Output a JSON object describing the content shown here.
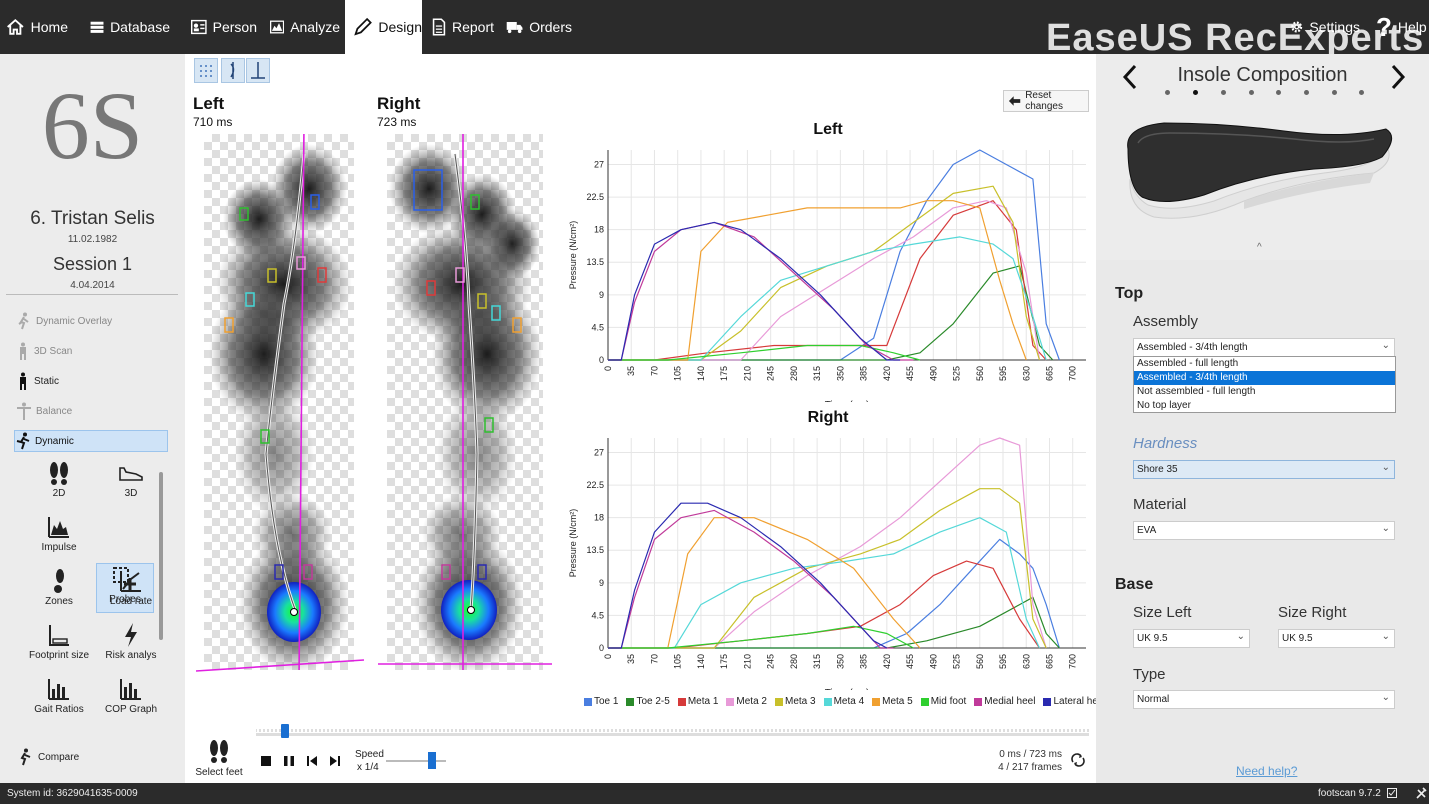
{
  "nav": {
    "home": "Home",
    "database": "Database",
    "person": "Person",
    "analyze": "Analyze",
    "design": "Design",
    "report": "Report",
    "orders": "Orders",
    "settings": "Settings",
    "help": "Help"
  },
  "watermark": "EaseUS RecExperts",
  "patient": {
    "size": "6S",
    "name": "6. Tristan Selis",
    "dob": "11.02.1982",
    "session": "Session 1",
    "session_date": "4.04.2014"
  },
  "menu": {
    "dynamic_overlay": "Dynamic Overlay",
    "scan_3d": "3D Scan",
    "static": "Static",
    "balance": "Balance",
    "dynamic": "Dynamic",
    "compare": "Compare"
  },
  "tools": {
    "t2d": "2D",
    "t3d": "3D",
    "impulse": "Impulse",
    "probes": "Probes",
    "zones": "Zones",
    "load_rate": "Load rate",
    "footprint_size": "Footprint size",
    "risk": "Risk analys",
    "gait_ratios": "Gait Ratios",
    "cop_graph": "COP Graph"
  },
  "feet": {
    "left_label": "Left",
    "left_ms": "710 ms",
    "right_label": "Right",
    "right_ms": "723 ms"
  },
  "reset_changes": "Reset changes",
  "playback": {
    "select_feet": "Select feet",
    "speed_label": "Speed",
    "speed_value": "x 1/4",
    "time": "0 ms / 723 ms",
    "frames": "4 / 217 frames",
    "position": 0.02,
    "speed_level": 0.6
  },
  "insole": {
    "title": "Insole Composition",
    "top": "Top",
    "assembly_label": "Assembly",
    "assembly_value": "Assembled - 3/4th length",
    "assembly_options": [
      "Assembled - full length",
      "Assembled - 3/4th length",
      "Not assembled - full length",
      "No top layer"
    ],
    "hardness_label": "Hardness",
    "hardness_value": "Shore 35",
    "material_label": "Material",
    "material_value": "EVA",
    "base": "Base",
    "size_left_label": "Size Left",
    "size_left_value": "UK 9.5",
    "size_right_label": "Size Right",
    "size_right_value": "UK 9.5",
    "type_label": "Type",
    "type_value": "Normal",
    "need_help": "Need help?"
  },
  "status": {
    "system_id": "System id: 3629041635-0009",
    "version": "footscan 9.7.2"
  },
  "colors": {
    "topbar": "#2b2b2b",
    "selection": "#0b74d7",
    "panel": "#ececec"
  },
  "chart_data": [
    {
      "type": "line",
      "title": "Left",
      "xlabel": "Time (ms)",
      "ylabel": "Pressure (N/cm²)",
      "x_ticks": [
        "0",
        "35",
        "70",
        "105",
        "140",
        "175",
        "210",
        "245",
        "280",
        "315",
        "350",
        "385",
        "420",
        "455",
        "490",
        "525",
        "560",
        "595",
        "630",
        "665",
        "700"
      ],
      "y_ticks": [
        "0",
        "4.5",
        "9",
        "13.5",
        "18",
        "22.5",
        "27"
      ],
      "xlim": [
        0,
        720
      ],
      "ylim": [
        0,
        29
      ],
      "series": [
        {
          "name": "Toe 1",
          "color": "#4a7ee0",
          "x": [
            0,
            350,
            400,
            440,
            480,
            520,
            560,
            600,
            640,
            660,
            680
          ],
          "y": [
            0,
            0,
            3,
            15,
            22,
            27,
            29,
            27,
            25,
            5,
            0
          ]
        },
        {
          "name": "Toe 2-5",
          "color": "#2a8a2a",
          "x": [
            0,
            420,
            470,
            520,
            580,
            620,
            650,
            670
          ],
          "y": [
            0,
            0,
            1,
            5,
            12,
            13,
            2,
            0
          ]
        },
        {
          "name": "Meta 1",
          "color": "#d63a3a",
          "x": [
            0,
            70,
            150,
            250,
            350,
            420,
            470,
            520,
            580,
            615,
            640,
            660
          ],
          "y": [
            0,
            0,
            1,
            2,
            2,
            2,
            14,
            20,
            22,
            18,
            2,
            0
          ]
        },
        {
          "name": "Meta 2",
          "color": "#e89ad8",
          "x": [
            0,
            200,
            260,
            330,
            400,
            460,
            520,
            570,
            600,
            630,
            650
          ],
          "y": [
            0,
            0,
            6,
            10,
            14,
            17,
            21,
            22,
            21,
            12,
            0
          ]
        },
        {
          "name": "Meta 3",
          "color": "#c8c02a",
          "x": [
            0,
            140,
            200,
            260,
            330,
            400,
            460,
            520,
            580,
            610,
            630,
            650
          ],
          "y": [
            0,
            0,
            4,
            10,
            13,
            15,
            19,
            23,
            24,
            19,
            6,
            0
          ]
        },
        {
          "name": "Meta 4",
          "color": "#55d8d8",
          "x": [
            0,
            140,
            200,
            260,
            330,
            400,
            460,
            530,
            580,
            610,
            640,
            660
          ],
          "y": [
            0,
            0,
            6,
            11,
            13,
            15,
            16,
            17,
            16,
            14,
            6,
            0
          ]
        },
        {
          "name": "Meta 5",
          "color": "#f0a030",
          "x": [
            0,
            120,
            140,
            180,
            240,
            300,
            360,
            440,
            480,
            520,
            560,
            590,
            610,
            630
          ],
          "y": [
            0,
            0,
            15,
            19,
            20,
            21,
            21,
            21,
            22,
            22,
            21,
            11,
            5,
            0
          ]
        },
        {
          "name": "Mid foot",
          "color": "#2fcf2f",
          "x": [
            0,
            90,
            200,
            300,
            380,
            430,
            470
          ],
          "y": [
            0,
            0,
            1,
            2,
            2,
            1,
            0
          ]
        },
        {
          "name": "Medial heel",
          "color": "#c03a9a",
          "x": [
            0,
            20,
            40,
            70,
            110,
            160,
            220,
            280,
            340,
            390,
            430,
            460
          ],
          "y": [
            0,
            0,
            8,
            15,
            18,
            19,
            17,
            12,
            7,
            2,
            0,
            0
          ]
        },
        {
          "name": "Lateral heel",
          "color": "#2a2ab0",
          "x": [
            0,
            20,
            40,
            70,
            110,
            160,
            200,
            260,
            320,
            380,
            420,
            440
          ],
          "y": [
            0,
            0,
            9,
            16,
            18,
            19,
            18,
            14,
            9,
            3,
            0,
            0
          ]
        }
      ]
    },
    {
      "type": "line",
      "title": "Right",
      "xlabel": "Time (ms)",
      "ylabel": "Pressure (N/cm²)",
      "x_ticks": [
        "0",
        "35",
        "70",
        "105",
        "140",
        "175",
        "210",
        "245",
        "280",
        "315",
        "350",
        "385",
        "420",
        "455",
        "490",
        "525",
        "560",
        "595",
        "630",
        "665",
        "700"
      ],
      "y_ticks": [
        "0",
        "4.5",
        "9",
        "13.5",
        "18",
        "22.5",
        "27"
      ],
      "xlim": [
        0,
        720
      ],
      "ylim": [
        0,
        29
      ],
      "series": [
        {
          "name": "Toe 1",
          "color": "#4a7ee0",
          "x": [
            0,
            400,
            450,
            500,
            550,
            590,
            620,
            640,
            660,
            680
          ],
          "y": [
            0,
            0,
            2,
            6,
            11,
            15,
            13,
            11,
            6,
            0
          ]
        },
        {
          "name": "Toe 2-5",
          "color": "#2a8a2a",
          "x": [
            0,
            420,
            480,
            560,
            620,
            640,
            660,
            680
          ],
          "y": [
            0,
            0,
            1,
            3,
            6,
            7,
            2,
            0
          ]
        },
        {
          "name": "Meta 1",
          "color": "#d63a3a",
          "x": [
            0,
            100,
            200,
            300,
            380,
            440,
            490,
            540,
            580,
            620,
            650
          ],
          "y": [
            0,
            0,
            1,
            2,
            3,
            6,
            10,
            12,
            11,
            4,
            0
          ]
        },
        {
          "name": "Meta 2",
          "color": "#e89ad8",
          "x": [
            0,
            160,
            220,
            300,
            380,
            440,
            500,
            560,
            590,
            620,
            640,
            660
          ],
          "y": [
            0,
            0,
            5,
            10,
            14,
            18,
            23,
            28,
            29,
            28,
            6,
            0
          ]
        },
        {
          "name": "Meta 3",
          "color": "#c8c02a",
          "x": [
            0,
            160,
            220,
            300,
            380,
            440,
            500,
            560,
            590,
            620,
            640,
            660
          ],
          "y": [
            0,
            0,
            7,
            11,
            13,
            15,
            19,
            22,
            22,
            20,
            4,
            0
          ]
        },
        {
          "name": "Meta 4",
          "color": "#55d8d8",
          "x": [
            0,
            100,
            140,
            200,
            280,
            360,
            430,
            500,
            560,
            600,
            630,
            650
          ],
          "y": [
            0,
            0,
            6,
            9,
            11,
            12,
            13,
            16,
            18,
            16,
            4,
            0
          ]
        },
        {
          "name": "Meta 5",
          "color": "#f0a030",
          "x": [
            0,
            90,
            120,
            160,
            220,
            300,
            370,
            430,
            470
          ],
          "y": [
            0,
            0,
            13,
            18,
            18,
            15,
            11,
            4,
            0
          ]
        },
        {
          "name": "Mid foot",
          "color": "#2fcf2f",
          "x": [
            0,
            90,
            200,
            300,
            370,
            420,
            460
          ],
          "y": [
            0,
            0,
            1,
            2,
            3,
            2,
            0
          ]
        },
        {
          "name": "Medial heel",
          "color": "#c03a9a",
          "x": [
            0,
            20,
            40,
            70,
            110,
            160,
            220,
            280,
            340,
            380,
            410,
            430
          ],
          "y": [
            0,
            0,
            7,
            15,
            18,
            19,
            16,
            12,
            7,
            3,
            0,
            0
          ]
        },
        {
          "name": "Lateral heel",
          "color": "#2a2ab0",
          "x": [
            0,
            20,
            40,
            70,
            110,
            150,
            200,
            260,
            320,
            370,
            400,
            420
          ],
          "y": [
            0,
            0,
            8,
            16,
            20,
            20,
            18,
            14,
            9,
            4,
            1,
            0
          ]
        }
      ]
    }
  ]
}
